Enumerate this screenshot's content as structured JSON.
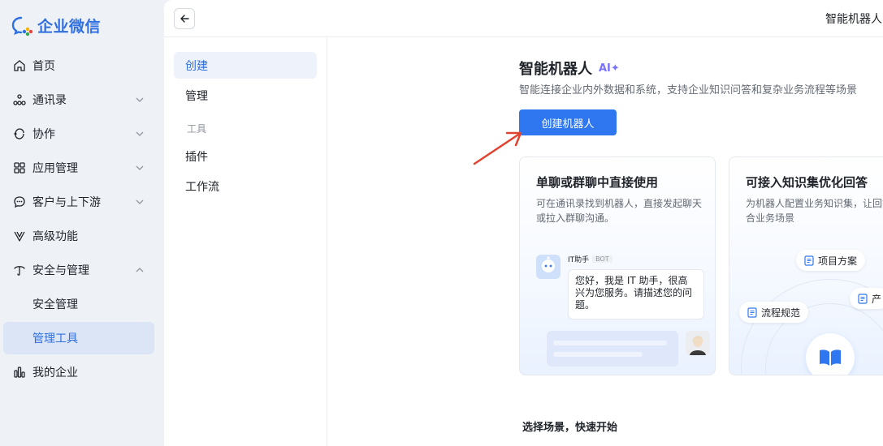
{
  "app": {
    "name": "企业微信",
    "brand_color": "#2f6fe0"
  },
  "sidebar": {
    "items": [
      {
        "label": "首页",
        "icon": "home-icon"
      },
      {
        "label": "通讯录",
        "icon": "org-icon"
      },
      {
        "label": "协作",
        "icon": "collab-icon"
      },
      {
        "label": "应用管理",
        "icon": "apps-icon"
      },
      {
        "label": "客户与上下游",
        "icon": "chat-icon"
      },
      {
        "label": "高级功能",
        "icon": "advanced-icon"
      },
      {
        "label": "安全与管理",
        "icon": "security-icon"
      },
      {
        "label": "安全管理"
      },
      {
        "label": "管理工具"
      },
      {
        "label": "我的企业",
        "icon": "company-icon"
      }
    ]
  },
  "topbar": {
    "title": "智能机器人"
  },
  "subnav": {
    "create": "创建",
    "manage": "管理",
    "tools_section": "工具",
    "plugins": "插件",
    "workflow": "工作流"
  },
  "main": {
    "title": "智能机器人",
    "ai_badge": "AI✦",
    "description": "智能连接企业内外数据和系统，支持企业知识问答和复杂业务流程等场景",
    "create_button": "创建机器人",
    "section_title": "选择场景，快速开始"
  },
  "cards": [
    {
      "title": "单聊或群聊中直接使用",
      "desc": "可在通讯录找到机器人，直接发起聊天或拉入群聊沟通。",
      "bot_name": "IT助手",
      "bot_tag": "BOT",
      "bubble": "您好，我是 IT 助手，很高兴为您服务。请描述您的问题。"
    },
    {
      "title": "可接入知识集优化回答",
      "desc": "为机器人配置业务知识集，让回答更契合业务场景",
      "chips": [
        "项目方案",
        "产",
        "流程规范"
      ]
    }
  ]
}
